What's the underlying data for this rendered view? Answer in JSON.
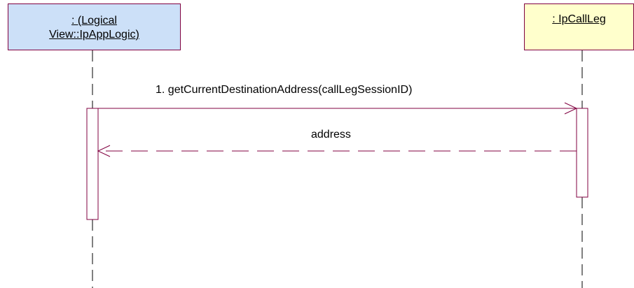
{
  "diagram": {
    "lifelines": [
      {
        "label": ": (Logical View::IpAppLogic)",
        "label_lines": [
          ": (Logical",
          "View::IpAppLogic)"
        ],
        "fill": "#cce0f8"
      },
      {
        "label": ": IpCallLeg",
        "fill": "#ffffcc"
      }
    ],
    "messages": [
      {
        "label": "1. getCurrentDestinationAddress(callLegSessionID)",
        "kind": "synchronous call"
      },
      {
        "label": "address",
        "kind": "return"
      }
    ],
    "colors": {
      "line": "#800040",
      "text": "#000000"
    }
  }
}
